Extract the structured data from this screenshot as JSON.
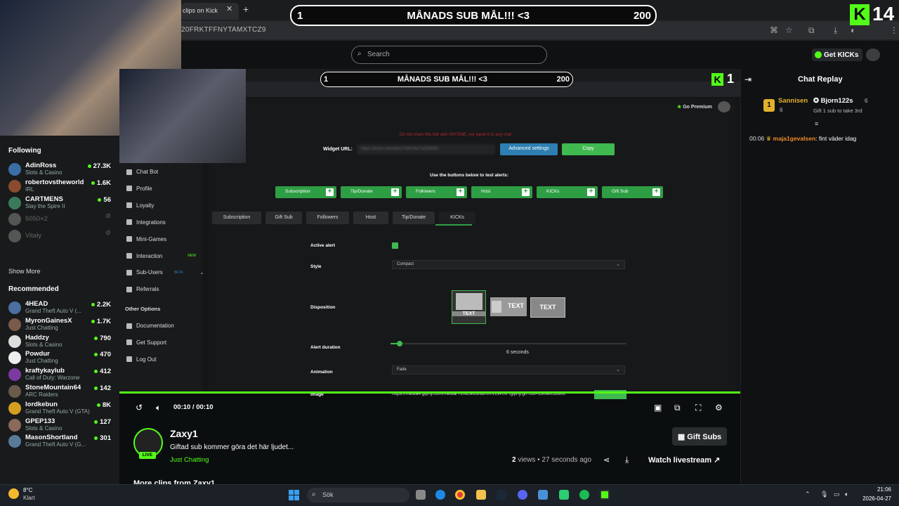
{
  "browser": {
    "tab_title": "clips on Kick",
    "url": "20FRKTFFNYTAMXTCZ9"
  },
  "banner": {
    "left_count": "1",
    "text": "MÅNADS SUB MÅL!!! <3",
    "right_count": "200"
  },
  "overlay_counter": "14",
  "inner_overlay_counter": "1",
  "kick": {
    "search_placeholder": "Search",
    "get_kicks_label": "Get KICKs"
  },
  "sidebar": {
    "following_title": "Following",
    "following": [
      {
        "name": "AdinRoss",
        "category": "Slots & Casino",
        "viewers": "27.3K",
        "live": true,
        "color": "#3b6ea5"
      },
      {
        "name": "robertovstheworld",
        "category": "IRL",
        "viewers": "1.6K",
        "live": true,
        "color": "#8a4b2e"
      },
      {
        "name": "CARTMENS",
        "category": "Slay the Spire II",
        "viewers": "56",
        "live": true,
        "color": "#3a7a5a"
      },
      {
        "name": "5050×2",
        "category": "",
        "viewers": "",
        "live": false,
        "color": "#555"
      },
      {
        "name": "Vitaly",
        "category": "",
        "viewers": "",
        "live": false,
        "color": "#555"
      }
    ],
    "show_more_1": "Show More",
    "recommended_title": "Recommended",
    "recommended": [
      {
        "name": "4HEAD",
        "category": "Grand Theft Auto V (...",
        "viewers": "2.2K",
        "color": "#4a6fa0"
      },
      {
        "name": "MyronGainesX",
        "category": "Just Chatting",
        "viewers": "1.7K",
        "color": "#7a5a4a"
      },
      {
        "name": "Haddzy",
        "category": "Slots & Casino",
        "viewers": "790",
        "color": "#ddd"
      },
      {
        "name": "Powdur",
        "category": "Just Chatting",
        "viewers": "470",
        "color": "#eee"
      },
      {
        "name": "kraftykaylub",
        "category": "Call of Duty: Warzone",
        "viewers": "412",
        "color": "#7a3aa0"
      },
      {
        "name": "StoneMountain64",
        "category": "ARC Raiders",
        "viewers": "142",
        "color": "#6a5a4a"
      },
      {
        "name": "lordkebun",
        "category": "Grand Theft Auto V (GTA)",
        "viewers": "8K",
        "color": "#d4a020"
      },
      {
        "name": "GPEP133",
        "category": "Slots & Casino",
        "viewers": "127",
        "color": "#8a6a5a"
      },
      {
        "name": "MasonShortland",
        "category": "Grand Theft Auto V (G...",
        "viewers": "301",
        "color": "#5a7a9a"
      }
    ]
  },
  "dashboard": {
    "nav": [
      "Chat Bot",
      "Profile",
      "Loyalty",
      "Integrations",
      "Mini-Games",
      "Interaction",
      "Sub-Users",
      "Referrals"
    ],
    "nav_new_badge": "NEW",
    "nav_beta_badge": "BETA",
    "other_options_title": "Other Options",
    "other_nav": [
      "Documentation",
      "Get Support",
      "Log Out"
    ],
    "go_premium": "Go Premium",
    "warning": "Do not share this link with ANYONE, nor paste it to any chat",
    "widget_url_label": "Widget URL:",
    "widget_url_value": "https://botrix.live/alerts?bid=9a7sd28fe5f1",
    "advanced_settings": "Advanced settings",
    "copy": "Copy",
    "test_label": "Use the buttons below to test alerts:",
    "test_buttons": [
      "Subscription",
      "Tip/Donate",
      "Followers",
      "Host",
      "KICKs",
      "Gift Sub"
    ],
    "alert_tabs": [
      "Subscription",
      "Gift Sub",
      "Followers",
      "Host",
      "Tip/Donate",
      "KICKs"
    ],
    "active_alert_label": "Active alert",
    "style_label": "Style",
    "style_value": "Compact",
    "disposition_label": "Disposition",
    "disposition_text": "TEXT",
    "alert_duration_label": "Alert duration",
    "alert_duration_value": "6 seconds",
    "alert_duration_seconds": 6,
    "animation_label": "Animation",
    "animation_value": "Fade",
    "image_label": "Image",
    "image_url": "https://media4.giphy.com/media/YGsCMGbsdRiRV29RXF/giphy.gif?cid=330fefc1890c"
  },
  "player": {
    "time": "00:10 / 00:10",
    "progress": 1.0
  },
  "clip": {
    "channel": "Zaxy1",
    "live_badge": "LIVE",
    "title": "Giftad sub kommer göra det här ljudet...",
    "category": "Just Chatting",
    "views_count": "2",
    "views_text": " views • 27 seconds ago",
    "gift_subs": "Gift Subs",
    "watch_livestream": "Watch livestream",
    "more_clips": "More clips from Zaxy1"
  },
  "chat": {
    "title": "Chat Replay",
    "top_gifter_rank": "1",
    "top_gifter_name": "Sannisen",
    "top_gifter_count": "6",
    "second_gifter_name": "Bjorn122s",
    "second_gifter_count": "6",
    "gift_message": "Gift 1 sub to take 3rd",
    "message": {
      "time": "00:06",
      "user": "maja1gevalsen",
      "text": "fint väder idag"
    }
  },
  "taskbar": {
    "temperature": "8°C",
    "weather": "Klart",
    "search_placeholder": "Sök",
    "time": "21:06",
    "date": "2026-04-27"
  },
  "colors": {
    "kick_green": "#53fc18",
    "button_green": "#2e9e44",
    "button_blue": "#2d7fb1",
    "gifter_gold": "#e1b12c",
    "chat_user": "#f08c2c"
  }
}
